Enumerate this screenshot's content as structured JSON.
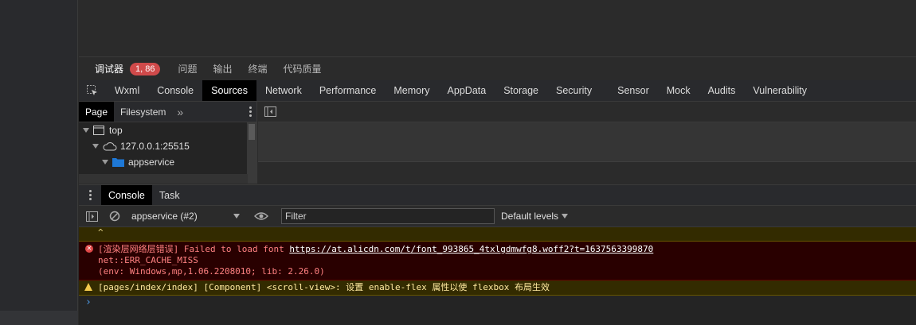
{
  "panel_tabs": [
    {
      "label": "调试器",
      "active": true
    },
    {
      "label": "问题"
    },
    {
      "label": "输出"
    },
    {
      "label": "终端"
    },
    {
      "label": "代码质量"
    }
  ],
  "badge": "1, 86",
  "devtools_tabs": [
    "Wxml",
    "Console",
    "Sources",
    "Network",
    "Performance",
    "Memory",
    "AppData",
    "Storage",
    "Security",
    "Sensor",
    "Mock",
    "Audits",
    "Vulnerability"
  ],
  "devtools_active": "Sources",
  "sources": {
    "subtabs": [
      "Page",
      "Filesystem"
    ],
    "more": "»",
    "tree": {
      "top": "top",
      "host": "127.0.0.1:25515",
      "folder": "appservice"
    }
  },
  "drawer": {
    "tabs": [
      "Console",
      "Task"
    ]
  },
  "console_toolbar": {
    "context": "appservice (#2)",
    "filter_placeholder": "Filter",
    "levels": "Default levels"
  },
  "messages": {
    "stub": "^",
    "error": {
      "prefix": "[渲染层网络层错误] Failed to load font ",
      "link": "https://at.alicdn.com/t/font_993865_4txlgdmwfg8.woff2?t=1637563399870",
      "line2": "net::ERR_CACHE_MISS",
      "line3": "(env: Windows,mp,1.06.2208010; lib: 2.26.0)"
    },
    "warning": "[pages/index/index] [Component] <scroll-view>: 设置 enable-flex 属性以使 flexbox 布局生效",
    "prompt": "›"
  },
  "icons": [
    "inspect-icon",
    "sidebar-toggle-icon",
    "window-icon",
    "cloud-icon",
    "folder-icon",
    "show-drawer-icon",
    "clear-console-icon",
    "eye-icon",
    "error-icon",
    "warning-icon"
  ],
  "colors": {
    "badge": "#d04a4a",
    "error_bg": "#290000",
    "warning_bg": "#332b00",
    "folder": "#1e78d6",
    "link": "#ffffff"
  }
}
